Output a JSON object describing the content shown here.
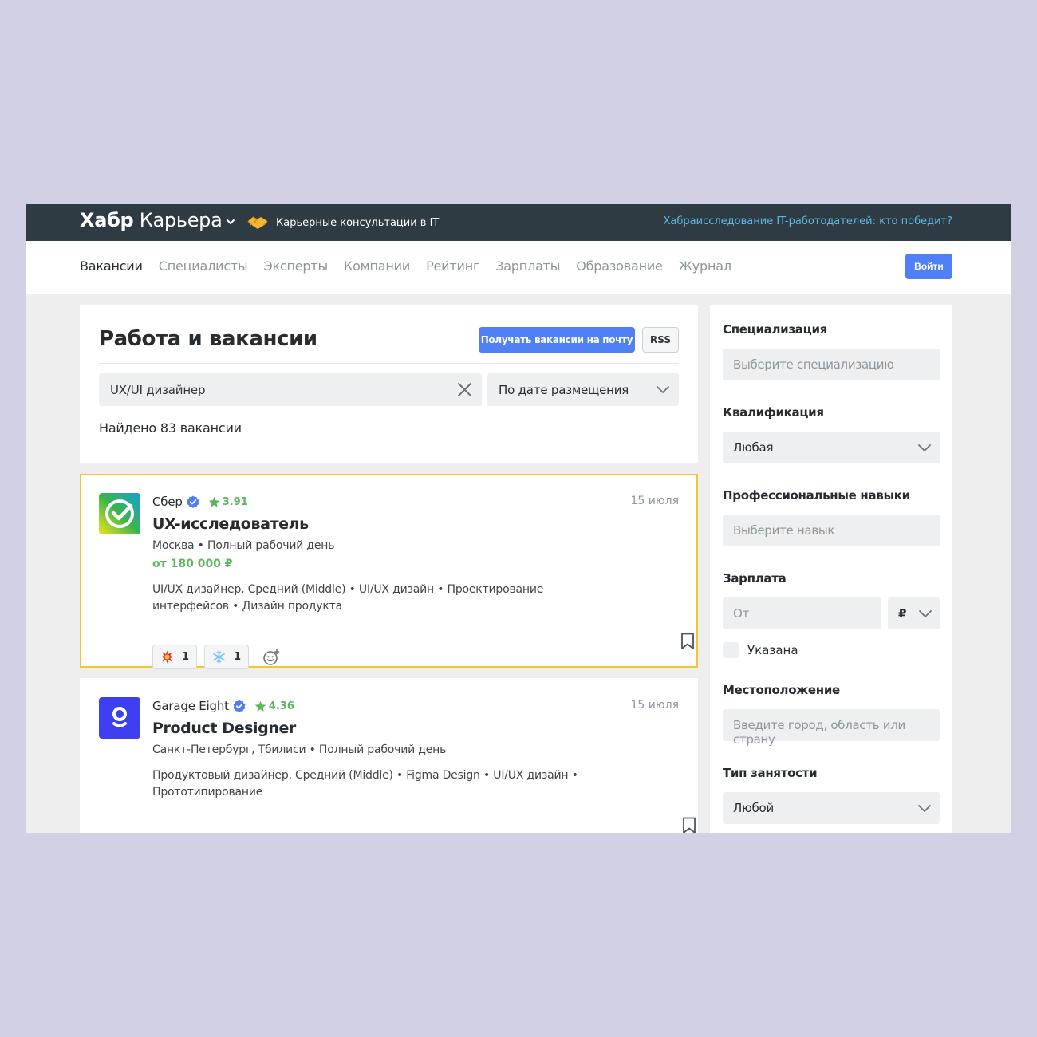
{
  "topbar": {
    "logo_main": "Хабр",
    "logo_sub": "Карьера",
    "consult_text": "Карьерные консультации в IT",
    "promo_link": "Хабраисследование IT-работодателей: кто победит?"
  },
  "nav": {
    "items": [
      "Вакансии",
      "Специалисты",
      "Эксперты",
      "Компании",
      "Рейтинг",
      "Зарплаты",
      "Образование",
      "Журнал"
    ],
    "login_label": "Войти"
  },
  "header": {
    "title": "Работа и вакансии",
    "subscribe_label": "Получать вакансии на почту",
    "rss_label": "RSS",
    "search_value": "UX/UI дизайнер",
    "sort_value": "По дате размещения",
    "found_text": "Найдено 83 вакансии"
  },
  "vacancies": [
    {
      "company": "Сбер",
      "rating": "3.91",
      "date": "15 июля",
      "title": "UX-исследователь",
      "meta": "Москва • Полный рабочий день",
      "salary": "от 180 000 ₽",
      "skills": "UI/UX дизайнер, Средний (Middle) • UI/UX дизайн • Проектирование интерфейсов • Дизайн продукта",
      "reactions": [
        {
          "icon": "fire-icon",
          "count": "1"
        },
        {
          "icon": "snowflake-icon",
          "count": "1"
        }
      ]
    },
    {
      "company": "Garage Eight",
      "rating": "4.36",
      "date": "15 июля",
      "title": "Product Designer",
      "meta": "Санкт-Петербург, Тбилиси • Полный рабочий день",
      "skills": "Продуктовый дизайнер, Средний (Middle) • Figma Design • UI/UX дизайн • Прототипирование"
    }
  ],
  "sidebar": {
    "spec_label": "Специализация",
    "spec_placeholder": "Выберите специализацию",
    "qual_label": "Квалификация",
    "qual_value": "Любая",
    "skills_label": "Профессиональные навыки",
    "skills_placeholder": "Выберите навык",
    "salary_label": "Зарплата",
    "salary_placeholder": "От",
    "currency_value": "₽",
    "salary_checkbox_label": "Указана",
    "location_label": "Местоположение",
    "location_placeholder": "Введите город, область или страну",
    "employment_label": "Тип занятости",
    "employment_value": "Любой"
  },
  "colors": {
    "topbar_bg": "#2f3b43",
    "accent_blue": "#4f80f6",
    "promo_link": "#5bb9e6",
    "rating_green": "#58b65d",
    "highlight_border": "#f4c432"
  }
}
